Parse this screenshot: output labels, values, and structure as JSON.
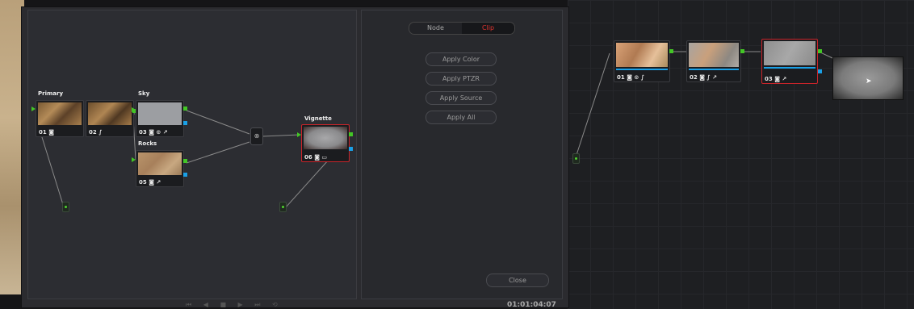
{
  "graph": {
    "nodes": [
      {
        "id": "01",
        "icons": "◙",
        "title": "Primary"
      },
      {
        "id": "02",
        "icons": "∫",
        "title": ""
      },
      {
        "id": "03",
        "icons": "◙ ⊙ ↗",
        "title": "Sky"
      },
      {
        "id": "05",
        "icons": "◙ ↗",
        "title": "Rocks"
      },
      {
        "id": "06",
        "icons": "◙ ▭",
        "title": "Vignette"
      }
    ],
    "mixer_icon": "⊗"
  },
  "panel": {
    "tabs": [
      "Node",
      "Clip"
    ],
    "active_tab": "Clip",
    "buttons": [
      "Apply Color",
      "Apply PTZR",
      "Apply Source",
      "Apply All"
    ],
    "close_label": "Close"
  },
  "right_graph": {
    "nodes": [
      {
        "id": "01",
        "icons": "◙ ⊙ ∫"
      },
      {
        "id": "02",
        "icons": "◙ ∫ ↗"
      },
      {
        "id": "03",
        "icons": "◙ ↗"
      }
    ]
  },
  "transport": {
    "controls": "⏮ ◀ ■ ▶ ⏭ ⟲",
    "timecode": "01:01:04:07"
  },
  "colors": {
    "accent_red": "#e3342f",
    "port_green": "#43c626",
    "port_blue": "#1aa0e6",
    "selected_border": "#c8242a"
  }
}
